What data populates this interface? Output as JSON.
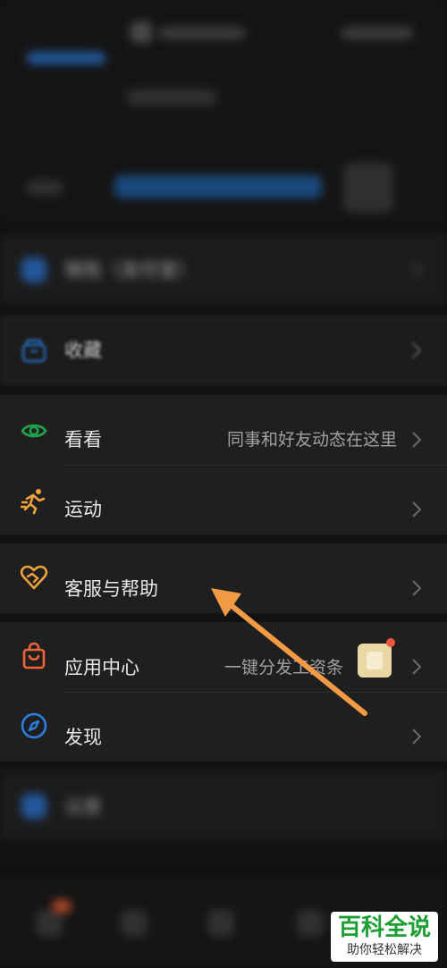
{
  "menu": {
    "pay_label": "钱包（支付宝）",
    "favorites_label": "收藏",
    "moments_label": "看看",
    "moments_hint": "同事和好友动态在这里",
    "sports_label": "运动",
    "service_label": "客服与帮助",
    "apps_label": "应用中心",
    "apps_hint": "一键分发工资条",
    "discover_label": "发现",
    "settings_label": "设置"
  },
  "icons": {
    "favorites": "favorites-box-icon",
    "moments": "eye-icon",
    "sports": "running-icon",
    "service": "heart-handshake-icon",
    "apps": "shopping-bag-icon",
    "discover": "compass-icon",
    "chevron": "chevron-right-icon"
  },
  "colors": {
    "background": "#111111",
    "section": "#1f1f1f",
    "moments_icon": "#1fa34a",
    "sports_icon": "#f2a33a",
    "service_icon": "#f2a33a",
    "apps_icon": "#f0643a",
    "discover_icon": "#2a7ee0",
    "arrow": "#f39a45"
  },
  "watermark": {
    "main": "百科全说",
    "sub": "助你轻松解决"
  }
}
